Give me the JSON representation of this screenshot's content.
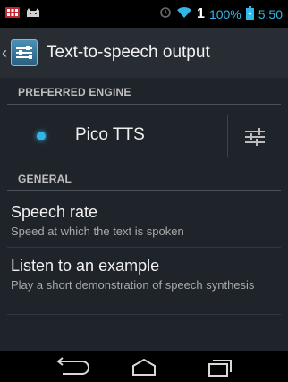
{
  "status_bar": {
    "left_icons": [
      "notification-icon",
      "cat-icon"
    ],
    "right_icons": [
      "alarm-icon",
      "wifi-icon",
      "signal-icon",
      "battery-icon"
    ],
    "signal_text": "1",
    "battery_text": "100%",
    "time": "5:50"
  },
  "action_bar": {
    "title": "Text-to-speech output",
    "up_icon": "chevron-left-icon",
    "app_icon": "settings-sliders-icon"
  },
  "sections": {
    "preferred_engine": "PREFERRED ENGINE",
    "general": "GENERAL"
  },
  "engine": {
    "label": "Pico TTS",
    "selected": true,
    "settings_icon": "equalizer-icon"
  },
  "items": [
    {
      "title": "Speech rate",
      "summary": "Speed at which the text is spoken"
    },
    {
      "title": "Listen to an example",
      "summary": "Play a short demonstration of speech synthesis"
    }
  ],
  "nav_bar": {
    "back": "back-icon",
    "home": "home-icon",
    "recents": "recent-apps-icon"
  },
  "colors": {
    "accent": "#33b5e5",
    "action_bar": "#282d33",
    "background": "#1f242a"
  }
}
